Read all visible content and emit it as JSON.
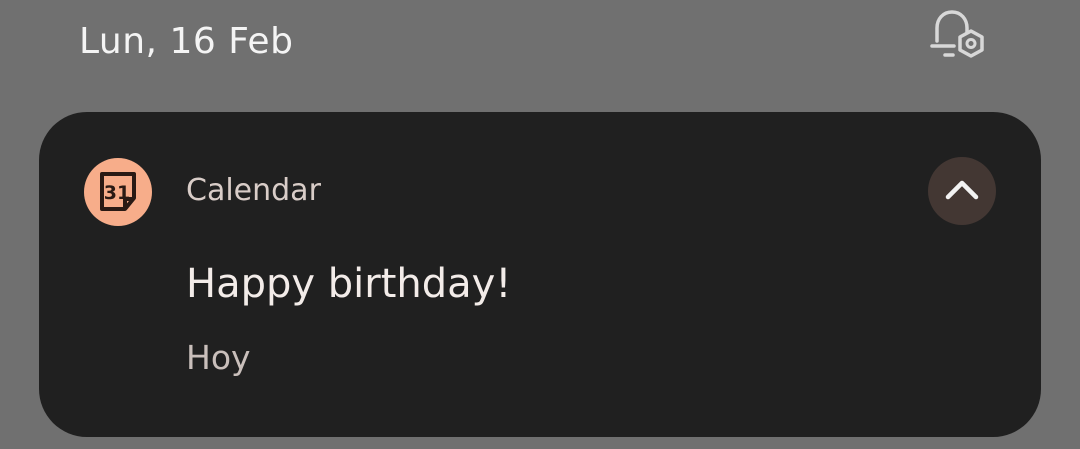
{
  "status": {
    "date": "Lun, 16 Feb"
  },
  "notification": {
    "app_name": "Calendar",
    "app_icon_text": "31",
    "title": "Happy birthday!",
    "subtitle": "Hoy",
    "icons": {
      "app": "calendar-31-icon",
      "expand": "chevron-up-icon",
      "settings": "notification-settings-icon"
    }
  },
  "colors": {
    "background": "#707070",
    "card": "#202020",
    "app_icon_bg": "#f7ad8a",
    "expand_bg": "#433733"
  }
}
